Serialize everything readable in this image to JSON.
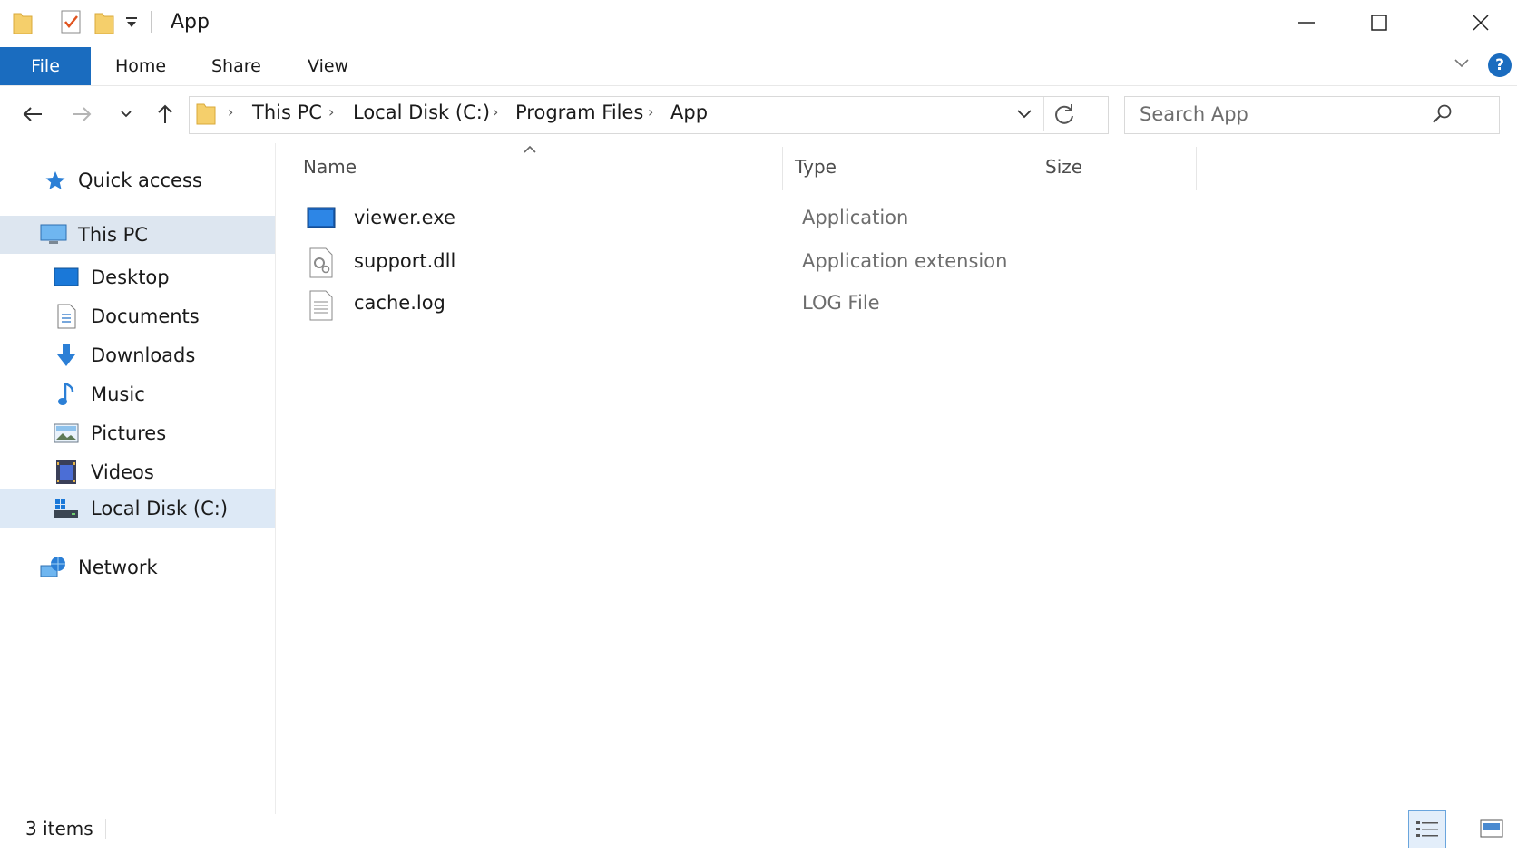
{
  "window": {
    "title": "App",
    "minimize_glyph": "—",
    "maximize_glyph": "☐",
    "close_glyph": "✕"
  },
  "ribbon": {
    "tabs": [
      "File",
      "Home",
      "Share",
      "View"
    ],
    "help_glyph": "?"
  },
  "address": {
    "breadcrumbs": [
      "This PC",
      "Local Disk (C:)",
      "Program Files",
      "App"
    ]
  },
  "search": {
    "placeholder": "Search App"
  },
  "sidebar": {
    "items": [
      {
        "label": "Quick access",
        "icon": "star-icon"
      },
      {
        "label": "This PC",
        "icon": "computer-icon"
      },
      {
        "label": "Desktop",
        "icon": "desktop-icon"
      },
      {
        "label": "Documents",
        "icon": "documents-icon"
      },
      {
        "label": "Downloads",
        "icon": "downloads-icon"
      },
      {
        "label": "Music",
        "icon": "music-icon"
      },
      {
        "label": "Pictures",
        "icon": "pictures-icon"
      },
      {
        "label": "Videos",
        "icon": "videos-icon"
      },
      {
        "label": "Local Disk (C:)",
        "icon": "drive-icon"
      },
      {
        "label": "Network",
        "icon": "network-icon"
      }
    ]
  },
  "columns": [
    "Name",
    "Type",
    "Size"
  ],
  "files": [
    {
      "name": "viewer.exe",
      "type": "Application",
      "icon": "exe-icon"
    },
    {
      "name": "support.dll",
      "type": "Application extension",
      "icon": "dll-icon"
    },
    {
      "name": "cache.log",
      "type": "LOG File",
      "icon": "log-icon"
    }
  ],
  "status": {
    "item_count": "3 items"
  },
  "colors": {
    "accent": "#1a6cbf",
    "selected": "#dde6f0",
    "folder": "#f5cf6b"
  }
}
